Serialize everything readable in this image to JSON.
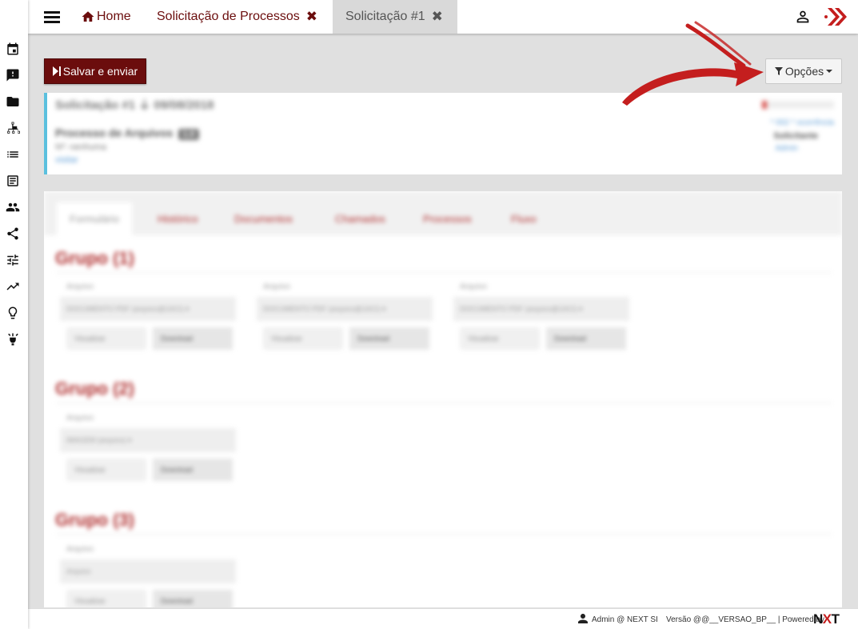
{
  "topbar": {
    "tabs": [
      {
        "label": "Home",
        "icon": "home-icon"
      },
      {
        "label": "Solicitação de Processos",
        "close": "✖"
      },
      {
        "label": "Solicitação #1",
        "close": "✖"
      }
    ]
  },
  "sidebar": {
    "icons": [
      "calendar-icon",
      "feedback-icon",
      "folder-icon",
      "org-chart-icon",
      "list-icon",
      "document-list-icon",
      "people-icon",
      "share-icon",
      "sliders-icon",
      "trending-icon",
      "lightbulb-icon",
      "spark-icon"
    ]
  },
  "toolbar": {
    "save_label": "Salvar e enviar",
    "options_label": "Opções"
  },
  "info_card": {
    "title": "Solicitação #1 ⏚ 09/08/2018",
    "process": "Processo de Arquivos",
    "badge": "1.0",
    "subtitle": "Nº: nenhuma",
    "link": "visitar",
    "right_link": "* 002 * ocorrência",
    "right_label": "Solicitante",
    "right_value": "Admin"
  },
  "panel": {
    "tabs": [
      "Formulário",
      "Histórico",
      "Documentos",
      "Chamados",
      "Processos",
      "Fluxo"
    ],
    "groups": [
      {
        "title": "Grupo (1)",
        "fields": [
          {
            "label": "Arquivo",
            "value": "DOCUMENTO PDF (arquivo@1ACI) ▾",
            "b1": "Visualizar",
            "b2": "Download"
          },
          {
            "label": "Arquivo",
            "value": "DOCUMENTO PDF (arquivo@1ACI) ▾",
            "b1": "Visualizar",
            "b2": "Download"
          },
          {
            "label": "Arquivo",
            "value": "DOCUMENTO PDF (arquivo@1ACI) ▾",
            "b1": "Visualizar",
            "b2": "Download"
          }
        ]
      },
      {
        "title": "Grupo (2)",
        "fields": [
          {
            "label": "Arquivo",
            "value": "IMAGEM (arquivo) ▾",
            "b1": "Visualizar",
            "b2": "Download"
          }
        ]
      },
      {
        "title": "Grupo (3)",
        "fields": [
          {
            "label": "Arquivo",
            "value": "Arquivo",
            "b1": "Visualizar",
            "b2": "Download"
          }
        ]
      }
    ]
  },
  "footer": {
    "user": "Admin @ NEXT SI",
    "version": "Versão @@__VERSAO_BP__ | Powered by",
    "brand_a": "N",
    "brand_b": "X",
    "brand_c": "T"
  },
  "colors": {
    "accent": "#6b0d0d",
    "info_border": "#5bc0de",
    "arrow": "#c41e1e"
  }
}
